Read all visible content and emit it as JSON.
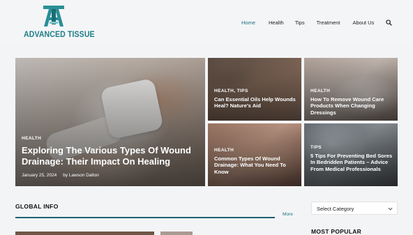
{
  "logo": {
    "text": "ADVANCED TISSUE",
    "color": "#1e7f86"
  },
  "nav": {
    "items": [
      {
        "label": "Home",
        "active": true
      },
      {
        "label": "Health"
      },
      {
        "label": "Tips"
      },
      {
        "label": "Treatment"
      },
      {
        "label": "About Us"
      }
    ],
    "search_icon": "search-icon",
    "active_color": "#1e6f80"
  },
  "featured": {
    "main": {
      "category": "HEALTH",
      "title": "Exploring The Various Types Of Wound Drainage: Their Impact On Healing",
      "date": "January 25, 2024",
      "author": "by Lawson Dalton"
    },
    "side": [
      {
        "category": "HEALTH, TIPS",
        "title": "Can Essential Oils Help Wounds Heal? Nature's Aid"
      },
      {
        "category": "HEALTH",
        "title": "How To Remove Wound Care Products When Changing Dressings"
      },
      {
        "category": "HEALTH",
        "title": "Common Types Of Wound Drainage: What You Need To Know"
      },
      {
        "category": "TIPS",
        "title": "5 Tips For Preventing Bed Sores In Bedridden Patients – Advice From Medical Professionals"
      }
    ]
  },
  "global_info": {
    "title": "GLOBAL INFO",
    "more": "More"
  },
  "sidebar": {
    "select_value": "Select Category",
    "most_popular_title": "MOST POPULAR"
  }
}
